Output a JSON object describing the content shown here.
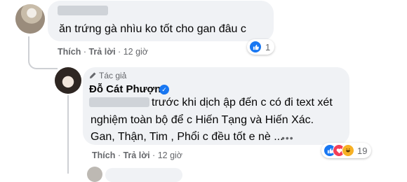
{
  "comment1": {
    "text": "ăn trứng gà nhìu ko tốt cho gan đâu c",
    "like_label": "Thích",
    "reply_label": "Trả lời",
    "time": "12 giờ",
    "reaction_count": "1"
  },
  "reply": {
    "author_tag": "Tác giả",
    "author_name": "Đỗ Cát Phượng",
    "line1": "trước khi dịch ập đến c có đi text xét",
    "line2": "nghiệm toàn bộ để c Hiến Tạng và Hiến Xác.",
    "line3": "Gan, Thận, Tim , Phổi c đều tốt e nè ...",
    "like_label": "Thích",
    "reply_label": "Trả lời",
    "time": "12 giờ",
    "reaction_count": "19"
  },
  "separator": "·",
  "icons": [
    "like-icon",
    "love-icon",
    "haha-icon",
    "verified-icon",
    "pen-icon",
    "more-options-icon"
  ],
  "colors": {
    "accent": "#1877f2",
    "bubble": "#f0f2f5",
    "meta": "#65676b",
    "love": "#f33e58",
    "haha": "#f7b125"
  }
}
